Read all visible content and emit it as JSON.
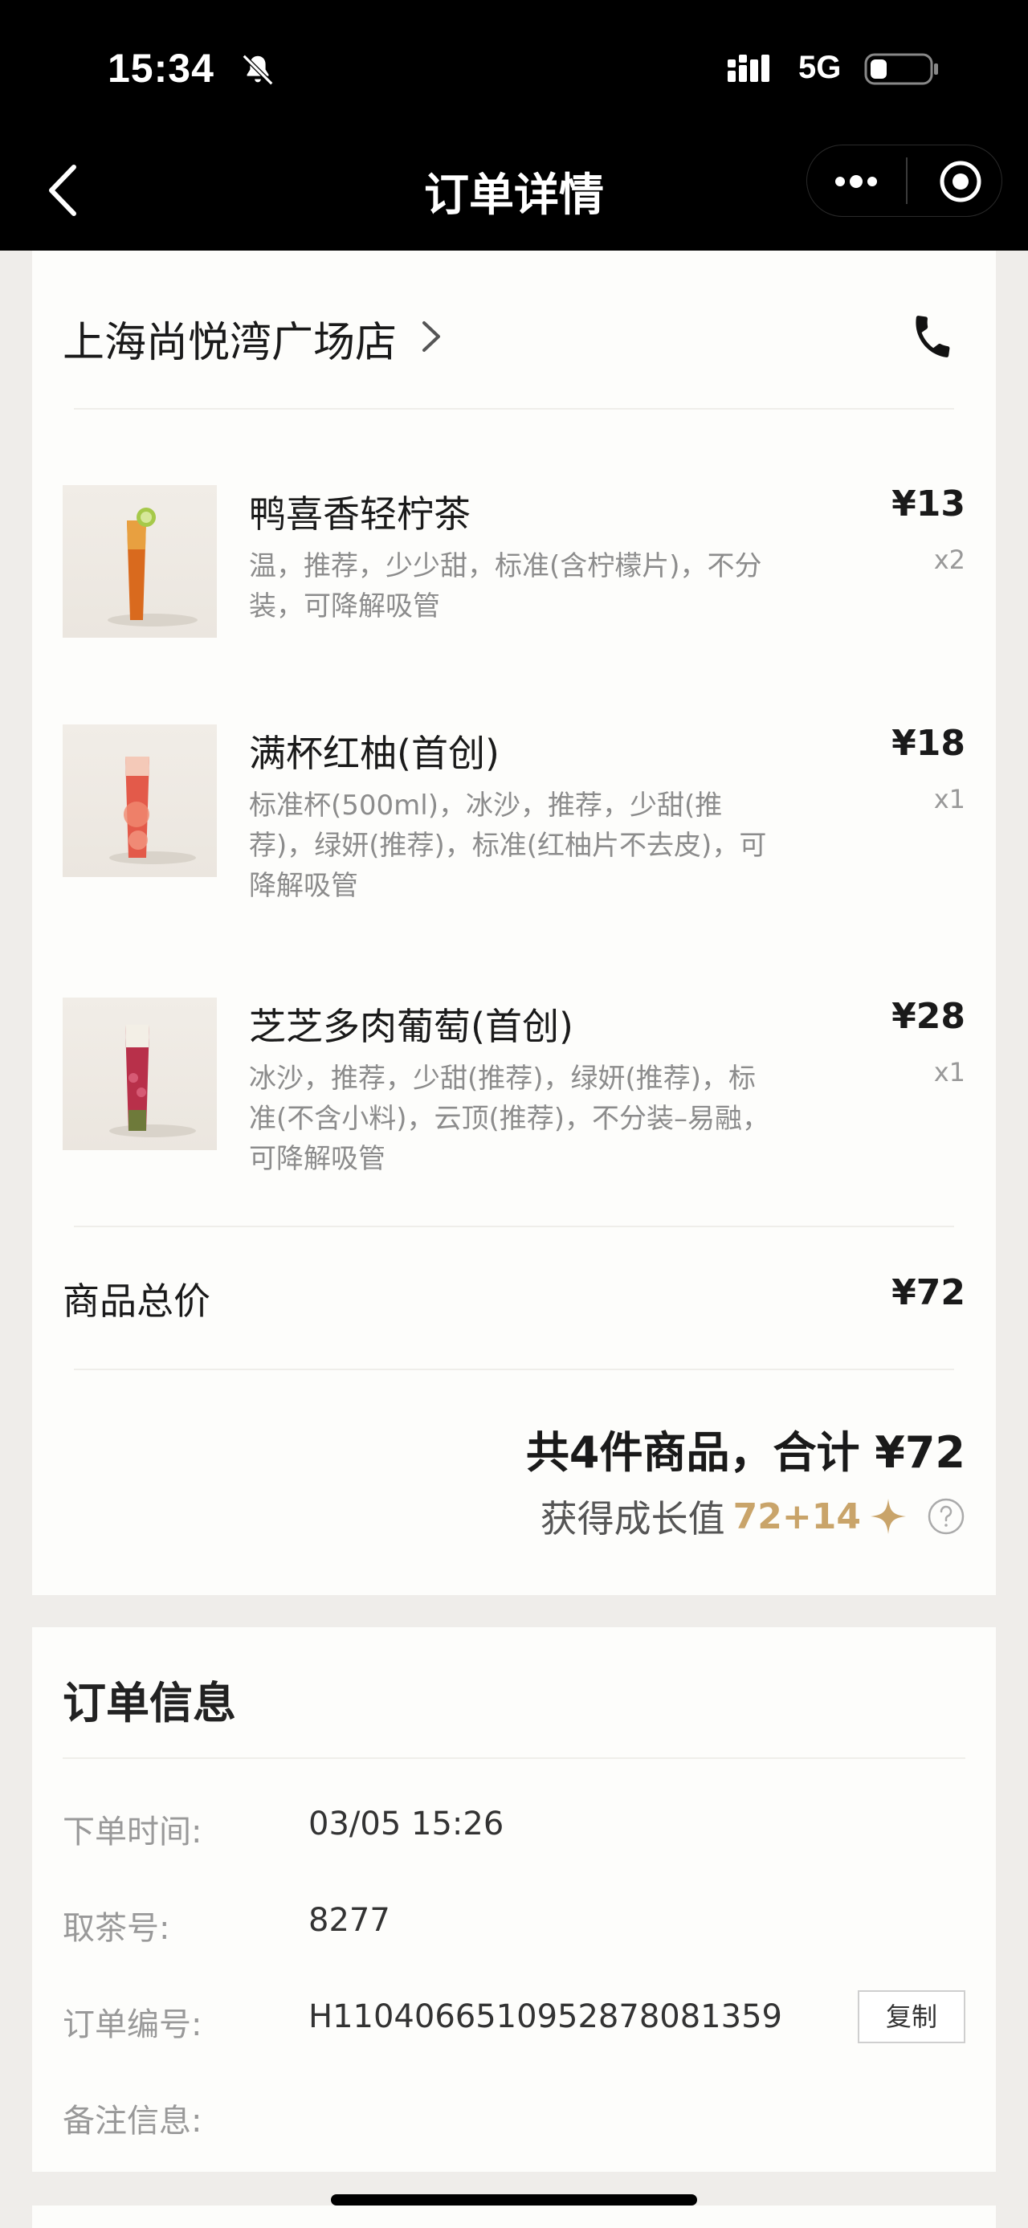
{
  "status_bar": {
    "time": "15:34",
    "network": "5G"
  },
  "nav": {
    "title": "订单详情"
  },
  "store": {
    "name": "上海尚悦湾广场店"
  },
  "items": [
    {
      "name": "鸭喜香轻柠茶",
      "desc": "温，推荐，少少甜，标准(含柠檬片)，不分装，可降解吸管",
      "price": "¥13",
      "qty": "x2"
    },
    {
      "name": "满杯红柚(首创)",
      "desc": "标准杯(500ml)，冰沙，推荐，少甜(推荐)，绿妍(推荐)，标准(红柚片不去皮)，可降解吸管",
      "price": "¥18",
      "qty": "x1"
    },
    {
      "name": "芝芝多肉葡萄(首创)",
      "desc": "冰沙，推荐，少甜(推荐)，绿妍(推荐)，标准(不含小料)，云顶(推荐)，不分装–易融，可降解吸管",
      "price": "¥28",
      "qty": "x1"
    }
  ],
  "summary": {
    "subtotal_label": "商品总价",
    "subtotal_value": "¥72",
    "total_text": "共4件商品，合计 ¥72",
    "growth_label": "获得成长值",
    "growth_value": "72+14"
  },
  "order_info": {
    "title": "订单信息",
    "rows": [
      {
        "label": "下单时间:",
        "value": "03/05 15:26"
      },
      {
        "label": "取茶号:",
        "value": "8277"
      },
      {
        "label": "订单编号:",
        "value": "H1104066510952878081359"
      },
      {
        "label": "备注信息:",
        "value": ""
      }
    ],
    "copy_label": "复制"
  },
  "colors": {
    "accent_gold": "#c9a46a",
    "nav_bg": "#000000",
    "page_bg": "#efedea"
  }
}
